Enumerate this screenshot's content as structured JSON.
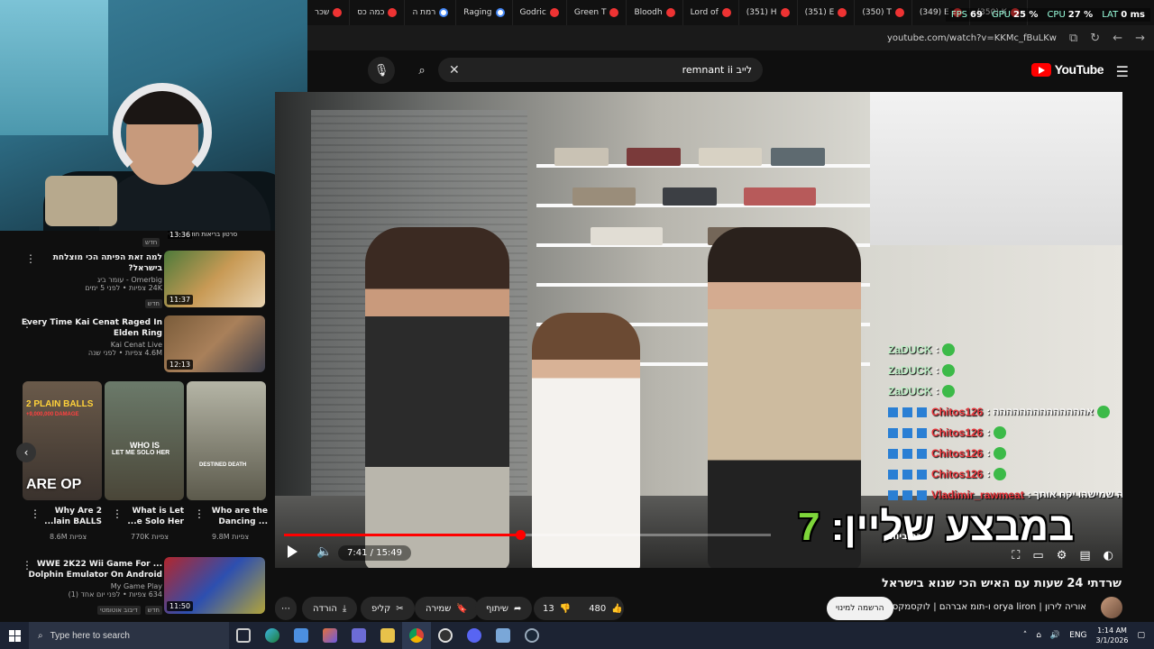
{
  "browser": {
    "tabs": [
      {
        "label": "שכר",
        "icon": "youtube-tab-icon"
      },
      {
        "label": "כמה כס",
        "icon": "tab-icon"
      },
      {
        "label": "רמת ה",
        "icon": "google-tab-icon"
      },
      {
        "label": "Raging",
        "icon": "google-tab-icon"
      },
      {
        "label": "Godric",
        "icon": "tab-icon"
      },
      {
        "label": "Green T",
        "icon": "tab-icon"
      },
      {
        "label": "Bloodh",
        "icon": "tab-icon"
      },
      {
        "label": "Lord of",
        "icon": "youtube-tab-icon"
      },
      {
        "label": "(351) H",
        "icon": "youtube-tab-icon"
      },
      {
        "label": "(351) E",
        "icon": "youtube-tab-icon"
      },
      {
        "label": "(350) T",
        "icon": "youtube-tab-icon"
      },
      {
        "label": "(349) E",
        "icon": "youtube-tab-icon"
      },
      {
        "label": "(350) K",
        "icon": "youtube-tab-icon"
      }
    ],
    "perf": {
      "fps_label": "FPS",
      "fps": "69",
      "gpu_label": "GPU",
      "gpu": "25 %",
      "cpu_label": "CPU",
      "cpu": "27 %",
      "lat_label": "LAT",
      "lat": "0 ms"
    },
    "url": "youtube.com/watch?v=KKMc_fBuLKw"
  },
  "youtube": {
    "search_value": "לייב remnant ii",
    "logo_text": "YouTube"
  },
  "sidebar": {
    "top_partial_caption": "סרטון בריאות חודש שני סי",
    "top_partial_duration": "13:36",
    "top_partial_badge": "חדש",
    "items": [
      {
        "title": "למה זאת הפיתה הכי מוצלחת בישראל?",
        "channel": "Omerbig - עומר ביג",
        "stats": "24K צפיות • לפני 5 ימים",
        "duration": "11:37",
        "badge": "חדש"
      },
      {
        "title": "Every Time Kai Cenat Raged In Elden Ring",
        "channel": "Kai Cenat Live",
        "stats": "4.6M צפיות • לפני שנה",
        "duration": "12:13",
        "badge": ""
      }
    ],
    "shorts": [
      {
        "title": "Why Are 2 ...lain BALLS",
        "views": "8.6M צפיות",
        "overlay_top": "2 PLAIN BALLS",
        "overlay_sub": "+9,000,000 DAMAGE",
        "overlay_bottom": "ARE OP"
      },
      {
        "title": "What is Let ...e Solo Her",
        "views": "770K צפיות",
        "overlay_top": "WHO IS",
        "overlay_sub": "LET ME SOLO HER",
        "overlay_bottom": ""
      },
      {
        "title": "Who are the Dancing ...",
        "views": "9.8M צפיות",
        "overlay_top": "",
        "overlay_sub": "DESTINED DEATH",
        "overlay_bottom": ""
      }
    ],
    "bottom_item": {
      "title": "WWE 2K22 Wii Game For ... Dolphin Emulator On Android",
      "channel": "My Game Play",
      "stats": "634 צפיות • לפני יום אחד (1)",
      "duration": "11:50",
      "badge1": "דיבוב אוטומטי",
      "badge2": "חדש"
    }
  },
  "player": {
    "current_time": "7:41",
    "duration": "15:49",
    "progress_fraction": 0.486,
    "overlay_caption": "במבצע שליין:",
    "overlay_number": "7",
    "subtitle_label": "כתוביות",
    "chat": [
      {
        "name": "ZaDUCK",
        "text": ":",
        "color": "green"
      },
      {
        "name": "ZaDUCK",
        "text": ":",
        "color": "green"
      },
      {
        "name": "ZaDUCK",
        "text": ":",
        "color": "green"
      },
      {
        "name": "Chitos126",
        "text": ": אהההההההההההההה",
        "color": "red"
      },
      {
        "name": "Chitos126",
        "text": ":",
        "color": "red"
      },
      {
        "name": "Chitos126",
        "text": ":",
        "color": "red"
      },
      {
        "name": "Chitos126",
        "text": ":",
        "color": "red"
      },
      {
        "name": "Vladimir_rawmeat",
        "text": ": איך אתה רוצה שמישהו יקח אותך",
        "color": "red"
      }
    ]
  },
  "video": {
    "title": "שרדתי 24 שעות עם האיש הכי שנוא בישראל",
    "channel": "אוריה לירון | orya liron ו-תומ אברהם | לוקסמקסינג",
    "subscribe_label": "הרשמה למינוי",
    "likes": "480",
    "dislikes": "13",
    "share_label": "שיתוף",
    "save_label": "שמירה",
    "clip_label": "קליפ",
    "download_label": "הורדה"
  },
  "taskbar": {
    "search_placeholder": "Type here to search",
    "lang": "ENG",
    "time": "1:14 AM",
    "date": "3/1/2026"
  },
  "colors": {
    "accent_red": "#ff0000",
    "chat_green": "#bff0c7",
    "chat_red": "#e7353b",
    "overlay_green": "#7ed63a"
  }
}
